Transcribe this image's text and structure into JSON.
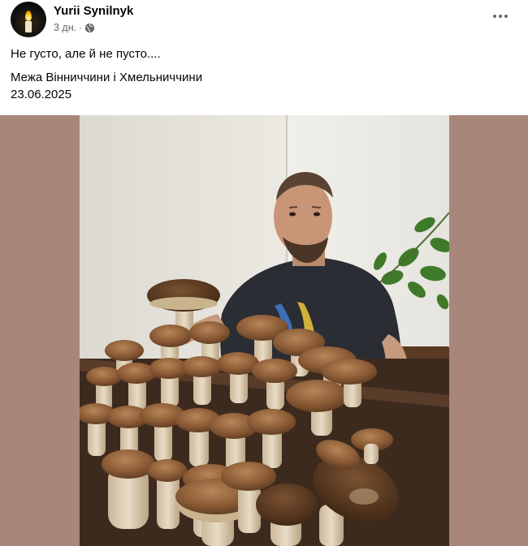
{
  "post": {
    "author": "Yurii Synilnyk",
    "time": "3 дн.",
    "separator": "·",
    "text_line1": "Не густо, але й не пусто....",
    "text_line2": "Межа Вінниччини і Хмельниччини",
    "text_line3": "23.06.2025"
  },
  "icons": {
    "avatar": "candle-avatar",
    "privacy": "globe-icon",
    "menu": "more-horizontal-icon"
  },
  "colors": {
    "frame_bg": "#a8867a",
    "meta_text": "#65676b"
  }
}
